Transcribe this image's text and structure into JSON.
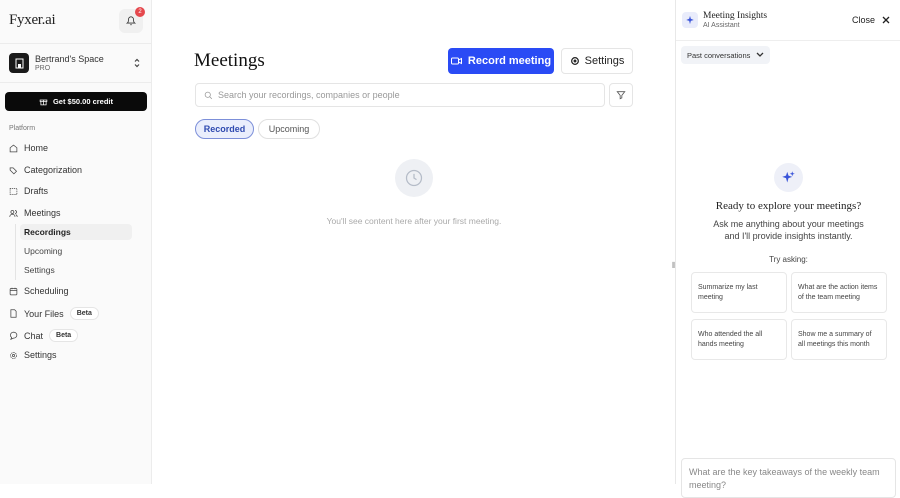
{
  "sidebar": {
    "logo": "Fyxer.ai",
    "notification_count": "2",
    "space_name": "Bertrand's Space",
    "plan": "PRO",
    "credit_button": "Get $50.00 credit",
    "section": "Platform",
    "nav": {
      "home": "Home",
      "categorization": "Categorization",
      "drafts": "Drafts",
      "meetings": "Meetings",
      "recordings": "Recordings",
      "upcoming": "Upcoming",
      "meetings_settings": "Settings",
      "scheduling": "Scheduling",
      "files": "Your Files",
      "files_badge": "Beta",
      "chat": "Chat",
      "chat_badge": "Beta",
      "settings": "Settings"
    }
  },
  "main": {
    "title": "Meetings",
    "record_button": "Record meeting",
    "settings_button": "Settings",
    "search_placeholder": "Search your recordings, companies or people",
    "tabs": {
      "recorded": "Recorded",
      "upcoming": "Upcoming"
    },
    "empty_text": "You'll see content here after your first meeting."
  },
  "panel": {
    "title": "Meeting Insights",
    "subtitle": "AI Assistant",
    "close": "Close",
    "past": "Past conversations",
    "heading": "Ready to explore your meetings?",
    "desc1": "Ask me anything about your meetings",
    "desc2": "and I'll provide insights instantly.",
    "try": "Try asking:",
    "suggestions": [
      "Summarize my last meeting",
      "What are the action items of the team meeting",
      "Who attended the all hands meeting",
      "Show me a summary of all meetings this month"
    ],
    "input_placeholder": "What are the key takeaways of the weekly team meeting?"
  },
  "colors": {
    "accent": "#2a4bf5",
    "badge": "#e5484d"
  }
}
